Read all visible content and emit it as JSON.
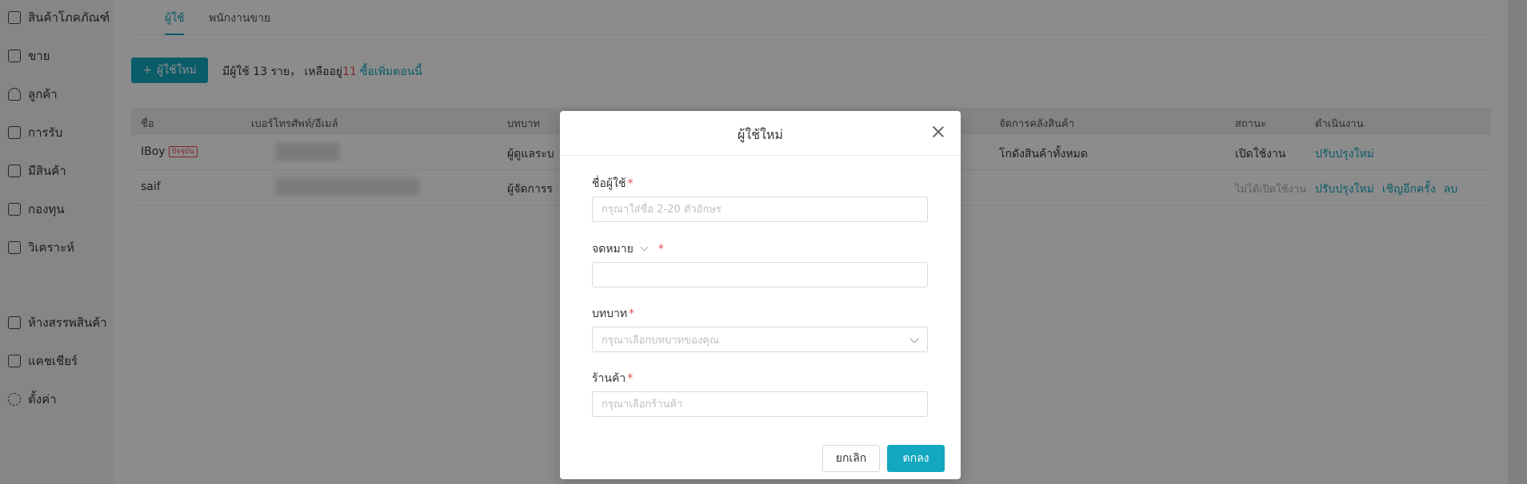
{
  "sidebar": {
    "items": [
      {
        "label": "สินค้าโภคภัณฑ์",
        "icon": "box-icon"
      },
      {
        "label": "ขาย",
        "icon": "clipboard-icon"
      },
      {
        "label": "ลูกค้า",
        "icon": "user-icon"
      },
      {
        "label": "การรับ",
        "icon": "receipt-icon"
      },
      {
        "label": "มีสินค้า",
        "icon": "home-icon"
      },
      {
        "label": "กองทุน",
        "icon": "folder-icon"
      },
      {
        "label": "วิเคราะห์",
        "icon": "analytics-icon"
      },
      {
        "label": "ห้างสรรพสินค้า",
        "icon": "store-icon"
      },
      {
        "label": "แคชเชียร์",
        "icon": "cashier-icon"
      },
      {
        "label": "ตั้งค่า",
        "icon": "gear-icon"
      }
    ]
  },
  "tabs": [
    {
      "label": "ผู้ใช้",
      "active": true
    },
    {
      "label": "พนักงานขาย",
      "active": false
    }
  ],
  "toolbar": {
    "add_label": "ผู้ใช้ใหม่",
    "summary_prefix": "มีผู้ใช้ 13 ราย， เหลืออยู่",
    "summary_remaining": "11",
    "buy_link": "ซื้อเพิ่มตอนนี้"
  },
  "table": {
    "headers": [
      "ชื่อ",
      "เบอร์โทรศัพท์/อีเมล์",
      "บทบาท",
      "จัดการคลังสินค้า",
      "สถานะ",
      "ดำเนินงาน"
    ],
    "rows": [
      {
        "name": "IBoy",
        "badge": "ปัจจุบัน",
        "role": "ผู้ดูแลระบ",
        "warehouse": "โกดังสินค้าทั้งหมด",
        "status": "เปิดใช้งาน",
        "actions": [
          "ปรับปรุงใหม่"
        ]
      },
      {
        "name": "saif",
        "badge": "",
        "role": "ผู้จัดการร",
        "warehouse": "",
        "status": "ไม่ได้เปิดใช้งาน",
        "actions": [
          "ปรับปรุงใหม่",
          "เชิญอีกครั้ง",
          "ลบ"
        ]
      }
    ]
  },
  "modal": {
    "title": "ผู้ใช้ใหม่",
    "fields": {
      "username": {
        "label": "ชื่อผู้ใช้",
        "placeholder": "กรุณาใส่ชื่อ 2-20 ตัวอักษร"
      },
      "email": {
        "label": "จดหมาย"
      },
      "role": {
        "label": "บทบาท",
        "placeholder": "กรุณาเลือกบทบาทของคุณ"
      },
      "store": {
        "label": "ร้านค้า",
        "placeholder": "กรุณาเลือกร้านค้า"
      }
    },
    "cancel_label": "ยกเลิก",
    "ok_label": "ตกลง",
    "required_mark": "*"
  }
}
